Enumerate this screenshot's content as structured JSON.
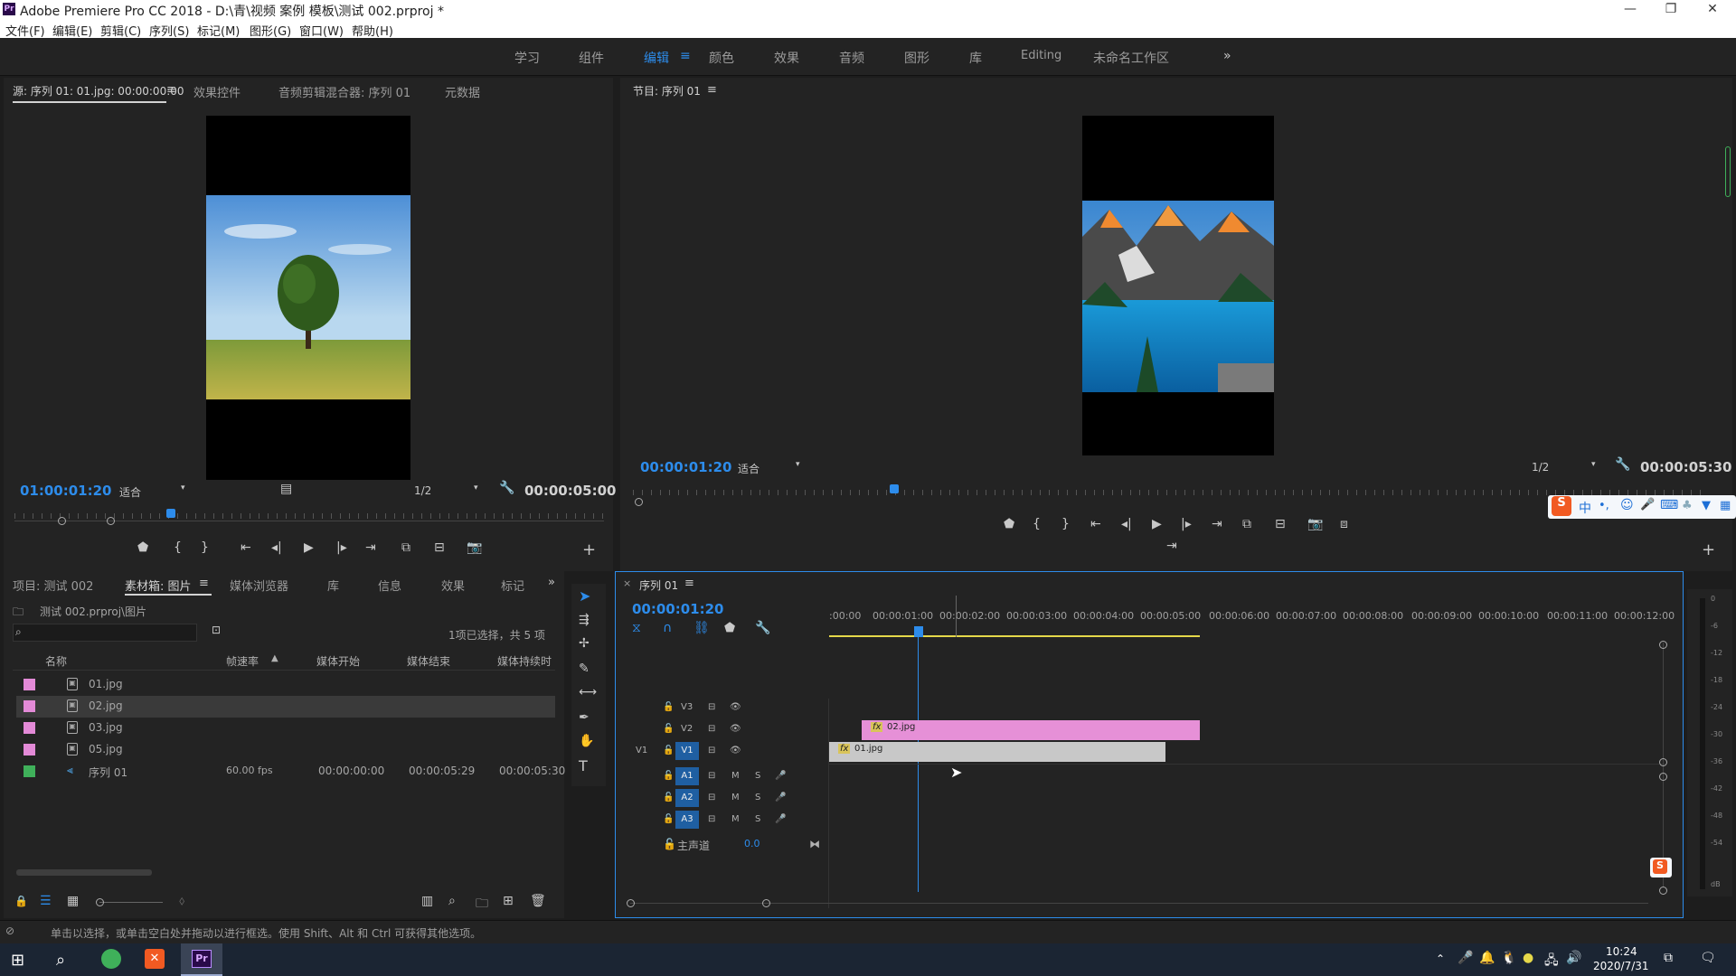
{
  "window": {
    "title": "Adobe Premiere Pro CC 2018 - D:\\青\\视频 案例 模板\\测试 002.prproj *",
    "minimize": "—",
    "restore": "❐",
    "close": "✕"
  },
  "menu": [
    "文件(F)",
    "编辑(E)",
    "剪辑(C)",
    "序列(S)",
    "标记(M)",
    "图形(G)",
    "窗口(W)",
    "帮助(H)"
  ],
  "workspaces": [
    "学习",
    "组件",
    "编辑",
    "颜色",
    "效果",
    "音频",
    "图形",
    "库",
    "Editing",
    "未命名工作区"
  ],
  "workspace_more": "»",
  "source": {
    "tabs": [
      "源: 序列 01: 01.jpg: 00:00:00:00",
      "效果控件",
      "音频剪辑混合器: 序列 01",
      "元数据"
    ],
    "timecode": "01:00:01:20",
    "fit": "适合",
    "res": "1/2",
    "duration": "00:00:05:00"
  },
  "program": {
    "tab": "节目: 序列 01",
    "timecode": "00:00:01:20",
    "fit": "适合",
    "res": "1/2",
    "duration": "00:00:05:30"
  },
  "project": {
    "tabs": [
      "项目: 测试 002",
      "素材箱: 图片",
      "媒体浏览器",
      "库",
      "信息",
      "效果",
      "标记"
    ],
    "path": "测试 002.prproj\\图片",
    "selection": "1项已选择，共 5 项",
    "columns": [
      "名称",
      "帧速率",
      "媒体开始",
      "媒体结束",
      "媒体持续时"
    ],
    "items": [
      {
        "name": "01.jpg",
        "color": "#e38ad7",
        "fps": "",
        "start": "",
        "end": "",
        "dur": ""
      },
      {
        "name": "02.jpg",
        "color": "#e38ad7",
        "fps": "",
        "start": "",
        "end": "",
        "dur": ""
      },
      {
        "name": "03.jpg",
        "color": "#e38ad7",
        "fps": "",
        "start": "",
        "end": "",
        "dur": ""
      },
      {
        "name": "05.jpg",
        "color": "#e38ad7",
        "fps": "",
        "start": "",
        "end": "",
        "dur": ""
      },
      {
        "name": "序列 01",
        "color": "#3fb05a",
        "fps": "60.00 fps",
        "start": "00:00:00:00",
        "end": "00:00:05:29",
        "dur": "00:00:05:30"
      }
    ]
  },
  "timeline": {
    "tab": "序列 01",
    "timecode": "00:00:01:20",
    "ticks": [
      ":00:00",
      "00:00:01:00",
      "00:00:02:00",
      "00:00:03:00",
      "00:00:04:00",
      "00:00:05:00",
      "00:00:06:00",
      "00:00:07:00",
      "00:00:08:00",
      "00:00:09:00",
      "00:00:10:00",
      "00:00:11:00",
      "00:00:12:00"
    ],
    "video_tracks": [
      "V3",
      "V2",
      "V1"
    ],
    "audio_tracks": [
      "A1",
      "A2",
      "A3"
    ],
    "src_v": "V1",
    "master_label": "主声道",
    "master_value": "0.0",
    "clip_v2": "02.jpg",
    "clip_v1": "01.jpg",
    "fx": "fx",
    "meter_ticks": [
      "0",
      "-6",
      "-12",
      "-18",
      "-24",
      "-30",
      "-36",
      "-42",
      "-48",
      "-54",
      "dB"
    ]
  },
  "status": "单击以选择，或单击空白处并拖动以进行框选。使用 Shift、Alt 和 Ctrl 可获得其他选项。",
  "taskbar": {
    "time": "10:24",
    "date": "2020/7/31"
  },
  "ime": [
    "中",
    "•,",
    "☺",
    "🎤",
    "⌨"
  ]
}
